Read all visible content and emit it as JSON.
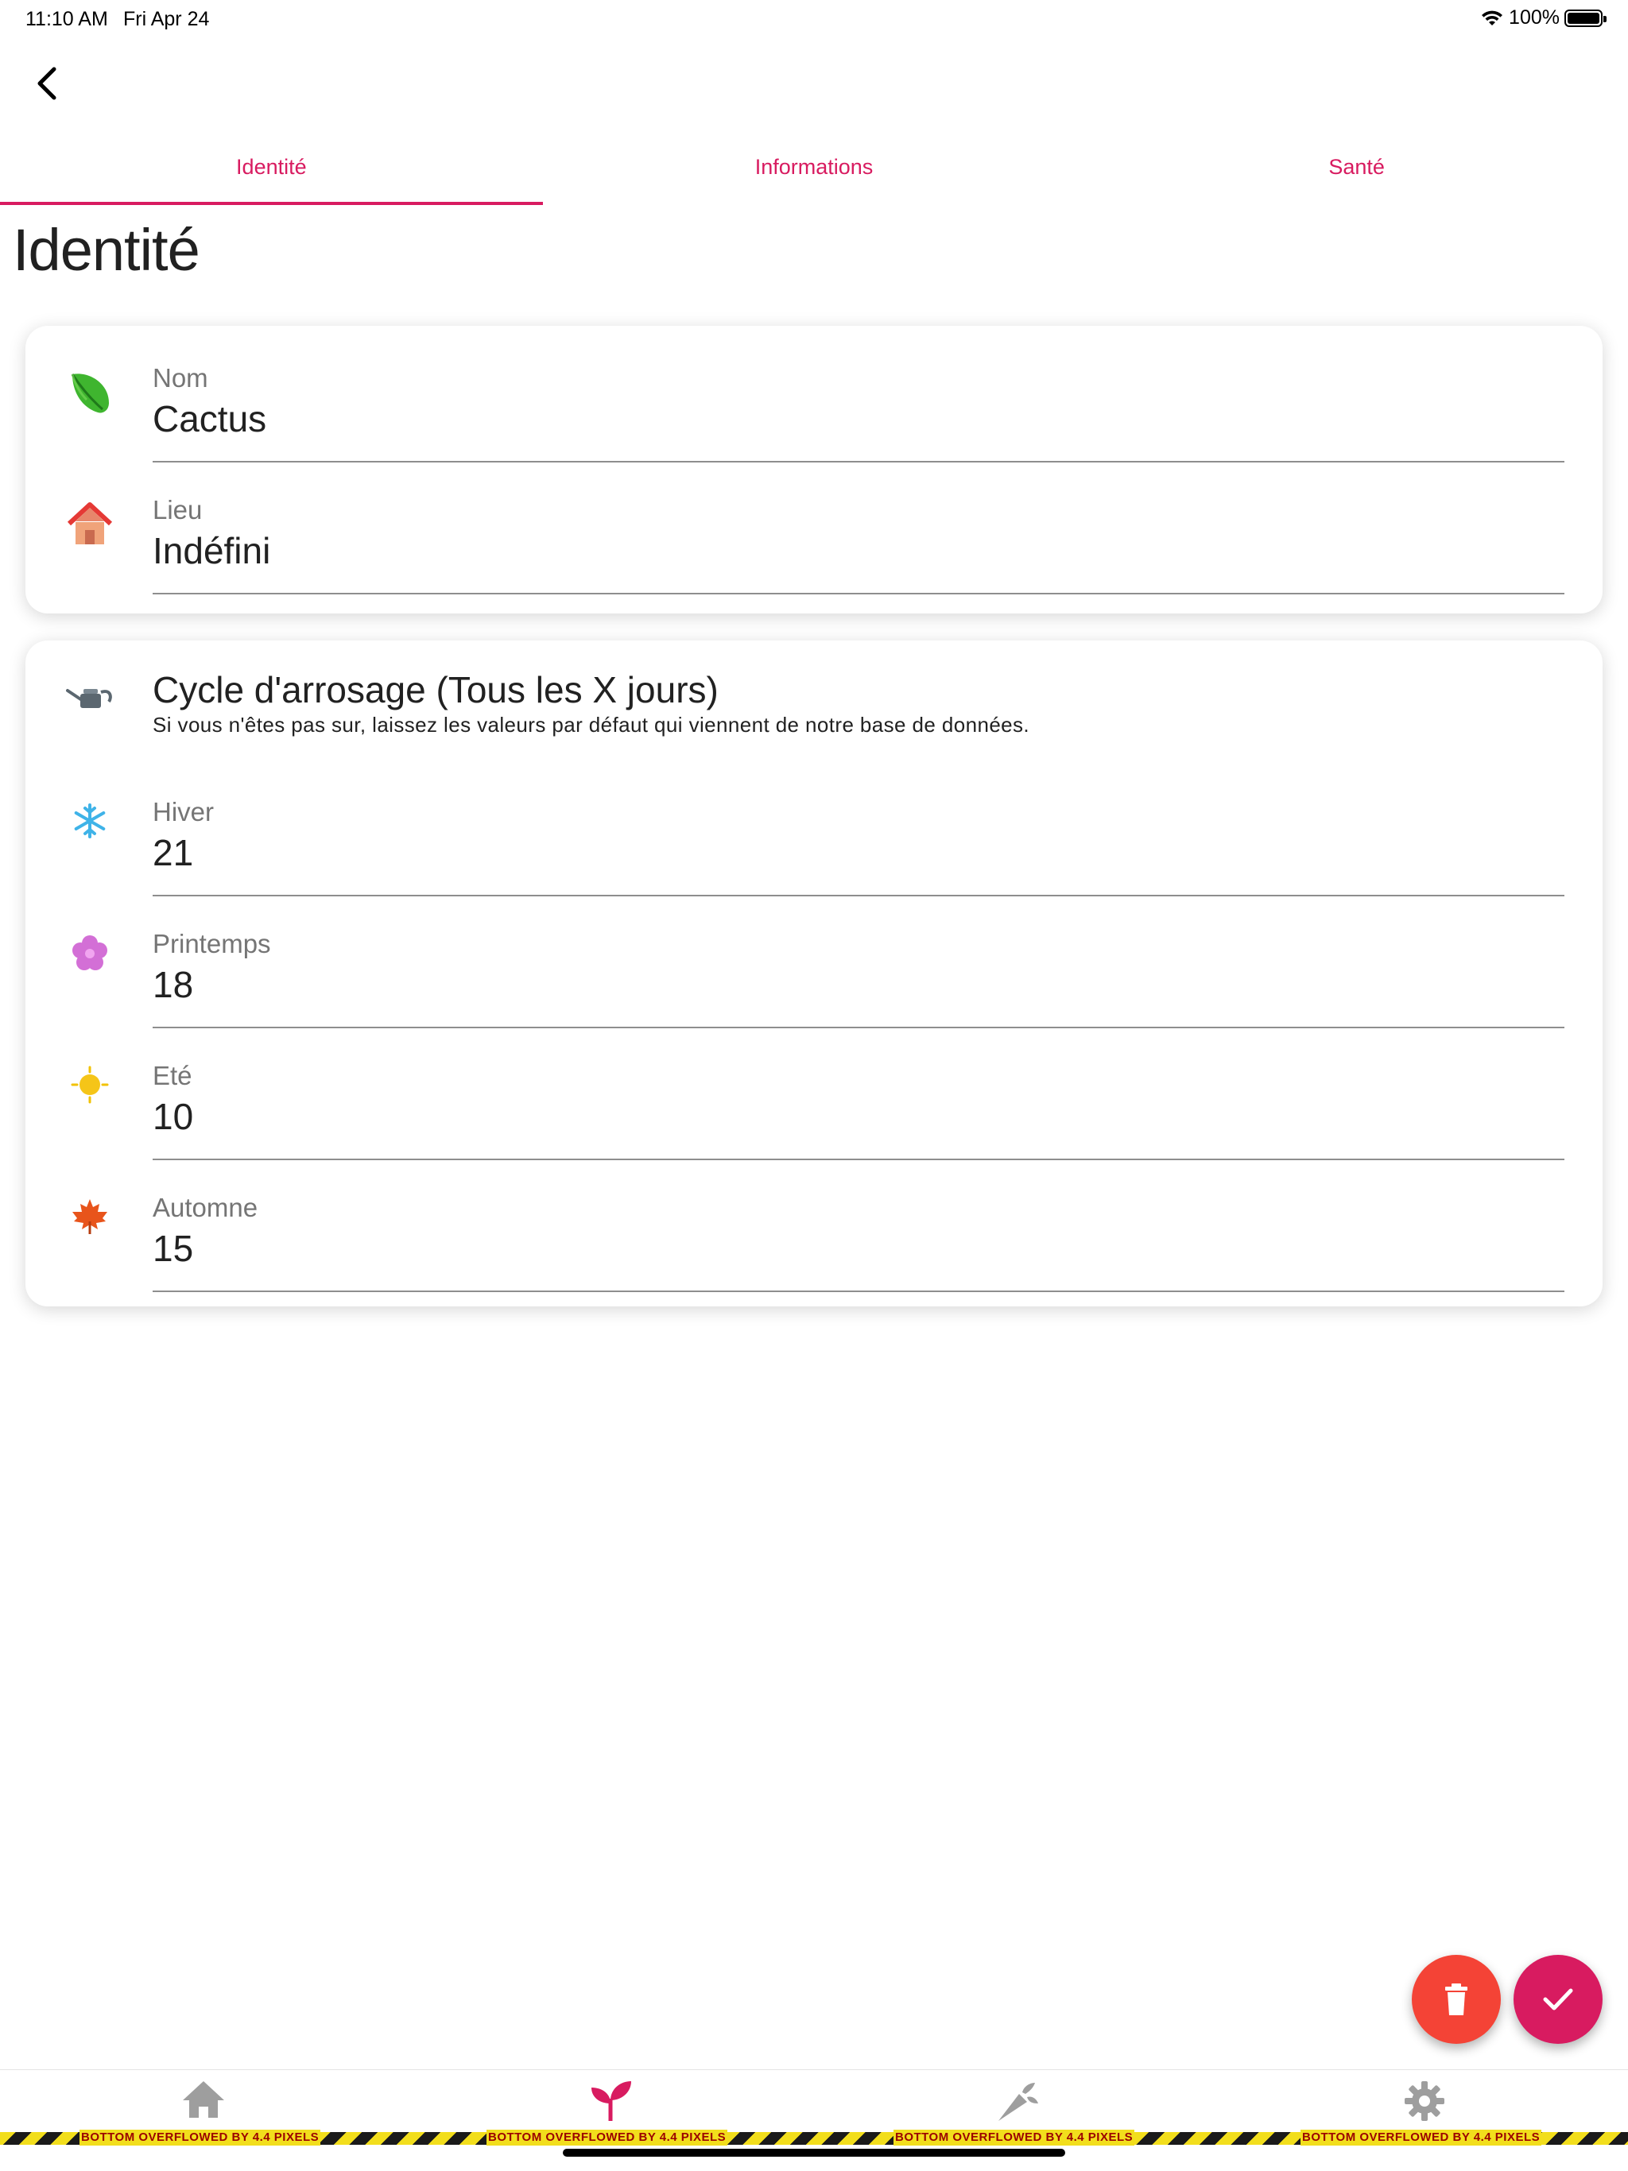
{
  "status_bar": {
    "time": "11:10 AM",
    "date": "Fri Apr 24",
    "battery": "100%"
  },
  "tabs": [
    {
      "label": "Identité",
      "active": true
    },
    {
      "label": "Informations",
      "active": false
    },
    {
      "label": "Santé",
      "active": false
    }
  ],
  "page_title": "Identité",
  "identity": {
    "name": {
      "label": "Nom",
      "value": "Cactus",
      "icon": "leaf-icon"
    },
    "location": {
      "label": "Lieu",
      "value": "Indéfini",
      "icon": "house-icon"
    }
  },
  "watering": {
    "title": "Cycle d'arrosage (Tous les X jours)",
    "hint": "Si vous n'êtes pas sur, laissez les valeurs par défaut qui viennent de notre base de données.",
    "icon": "watering-can-icon",
    "seasons": [
      {
        "label": "Hiver",
        "value": "21",
        "icon": "snowflake-icon"
      },
      {
        "label": "Printemps",
        "value": "18",
        "icon": "blossom-icon"
      },
      {
        "label": "Eté",
        "value": "10",
        "icon": "sun-icon"
      },
      {
        "label": "Automne",
        "value": "15",
        "icon": "maple-leaf-icon"
      }
    ]
  },
  "bottom_nav": {
    "items": [
      {
        "icon": "home-icon",
        "active": false
      },
      {
        "icon": "sprout-icon",
        "active": true
      },
      {
        "icon": "carrot-icon",
        "active": false
      },
      {
        "icon": "settings-icon",
        "active": false
      }
    ],
    "overflow_message": "BOTTOM OVERFLOWED BY 4.4 PIXELS"
  },
  "colors": {
    "accent": "#d81b60",
    "danger": "#f44336",
    "inactive_icon": "#9e9e9e"
  }
}
